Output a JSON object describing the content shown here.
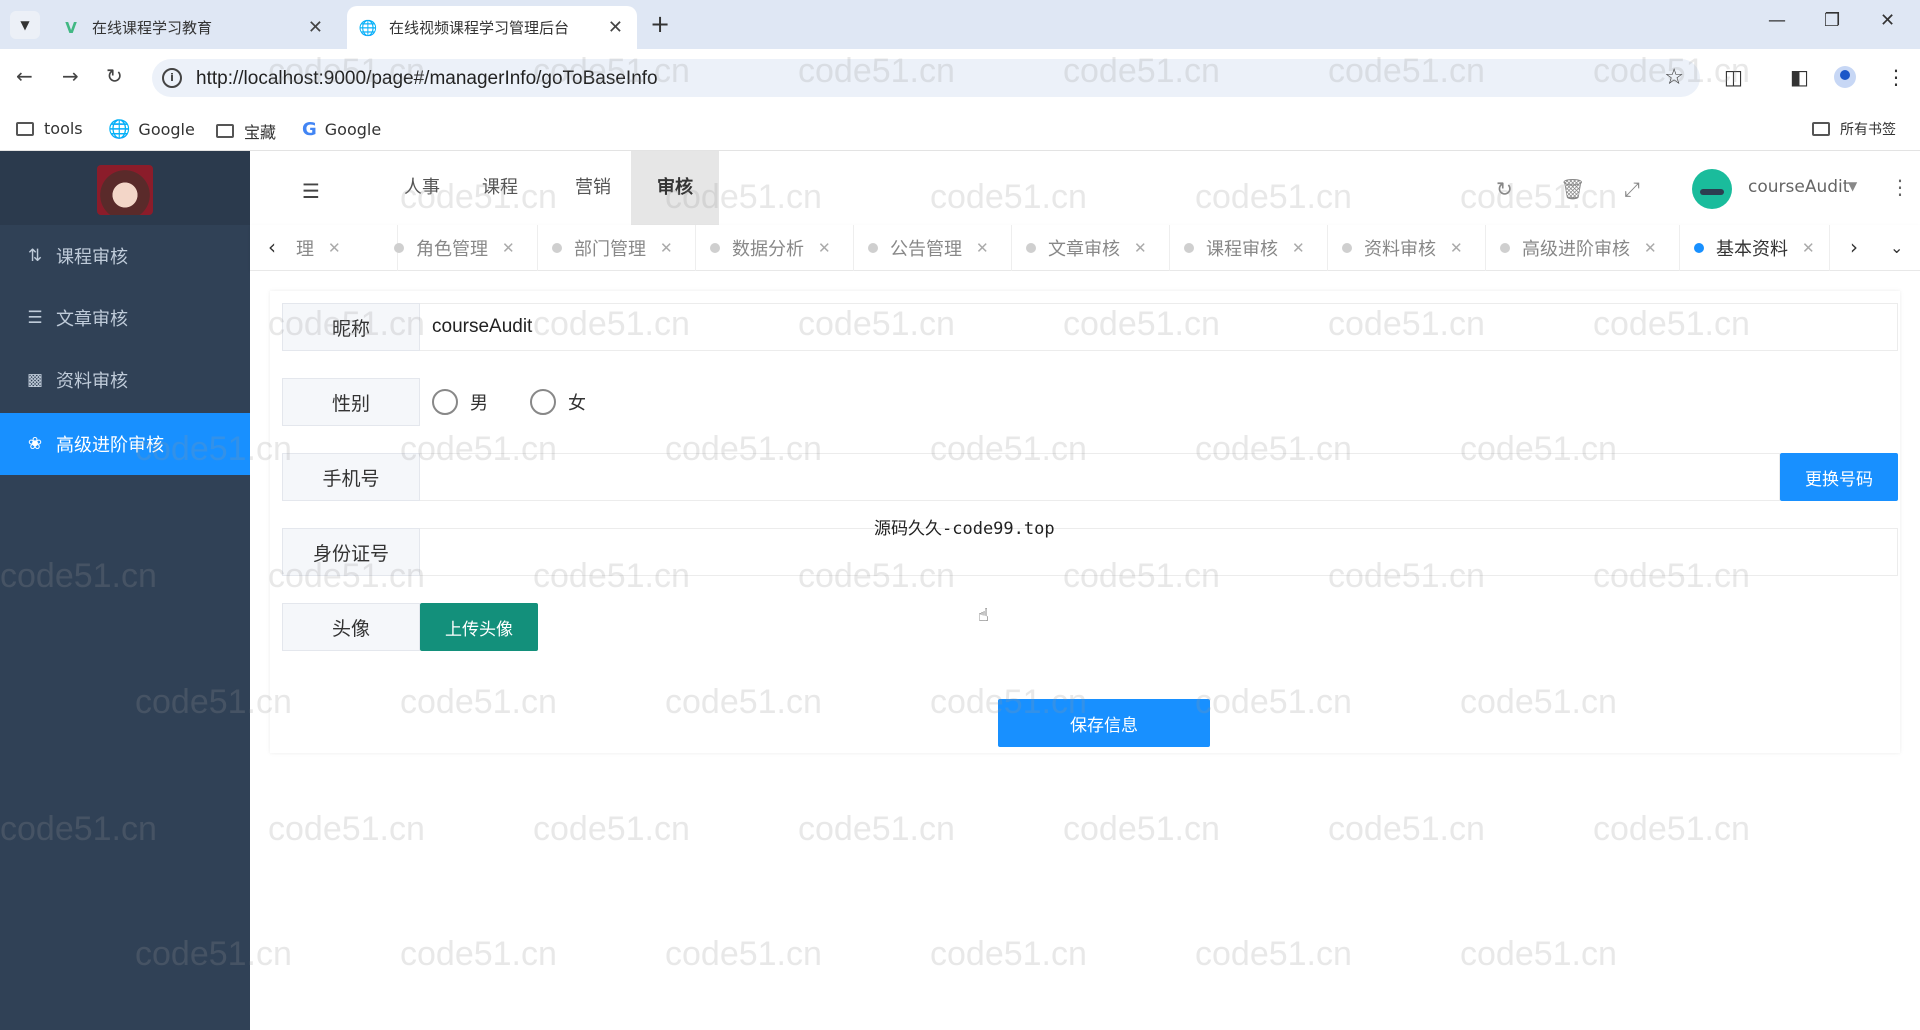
{
  "browser": {
    "tabs": [
      {
        "title": "在线课程学习教育",
        "active": false,
        "icon": "vue-logo-icon"
      },
      {
        "title": "在线视频课程学习管理后台",
        "active": true,
        "icon": "globe-icon"
      }
    ],
    "url": "http://localhost:9000/page#/managerInfo/goToBaseInfo",
    "bookmarks": [
      {
        "label": "tools",
        "icon": "folder-icon"
      },
      {
        "label": "Google",
        "icon": "globe-icon"
      },
      {
        "label": "宝藏",
        "icon": "folder-icon"
      },
      {
        "label": "Google",
        "icon": "google-icon"
      }
    ],
    "all_bookmarks": "所有书签"
  },
  "sidebar": {
    "items": [
      {
        "label": "课程审核",
        "icon": "sort-icon",
        "active": false
      },
      {
        "label": "文章审核",
        "icon": "book-icon",
        "active": false
      },
      {
        "label": "资料审核",
        "icon": "document-icon",
        "active": false
      },
      {
        "label": "高级进阶审核",
        "icon": "rebel-icon",
        "active": true
      }
    ]
  },
  "topnav": {
    "items": [
      "人事",
      "课程",
      "营销",
      "审核"
    ],
    "active": "审核",
    "user": "courseAudit"
  },
  "tagsview": {
    "tags": [
      {
        "label": "理",
        "active": false
      },
      {
        "label": "角色管理",
        "active": false
      },
      {
        "label": "部门管理",
        "active": false
      },
      {
        "label": "数据分析",
        "active": false
      },
      {
        "label": "公告管理",
        "active": false
      },
      {
        "label": "文章审核",
        "active": false
      },
      {
        "label": "课程审核",
        "active": false
      },
      {
        "label": "资料审核",
        "active": false
      },
      {
        "label": "高级进阶审核",
        "active": false
      },
      {
        "label": "基本资料",
        "active": true
      }
    ]
  },
  "form": {
    "nickname_label": "昵称",
    "nickname_value": "courseAudit",
    "gender_label": "性别",
    "gender_options": [
      "男",
      "女"
    ],
    "gender_selected": "",
    "phone_label": "手机号",
    "phone_value": "",
    "change_phone_button": "更换号码",
    "idcard_label": "身份证号",
    "idcard_value": "",
    "avatar_label": "头像",
    "upload_button": "上传头像",
    "save_button": "保存信息"
  },
  "overlay_text": "源码久久-code99.top",
  "watermark_text": "code51.cn",
  "colors": {
    "sidebar_bg": "#304156",
    "active_blue": "#1890ff",
    "upload_green": "#13907b"
  }
}
